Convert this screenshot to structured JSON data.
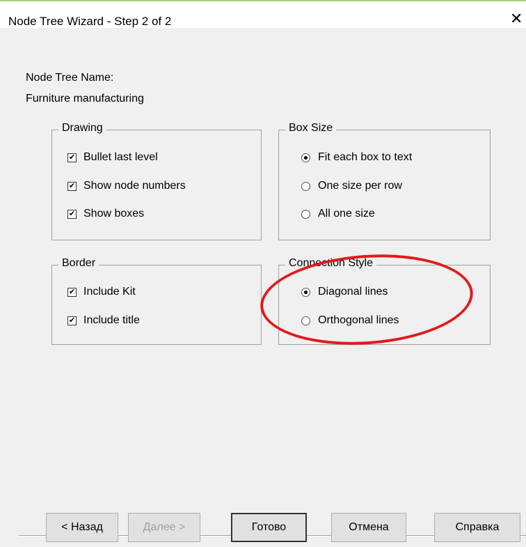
{
  "window": {
    "title": "Node Tree Wizard - Step 2 of 2",
    "close_glyph": "✕"
  },
  "node_tree": {
    "label": "Node Tree Name:",
    "value": "Furniture manufacturing"
  },
  "drawing": {
    "legend": "Drawing",
    "items": [
      {
        "label": "Bullet last level",
        "checked": true
      },
      {
        "label": "Show node numbers",
        "checked": true
      },
      {
        "label": "Show boxes",
        "checked": true
      }
    ]
  },
  "box_size": {
    "legend": "Box Size",
    "items": [
      {
        "label": "Fit each box to text",
        "selected": true
      },
      {
        "label": "One size per row",
        "selected": false
      },
      {
        "label": "All one size",
        "selected": false
      }
    ]
  },
  "border": {
    "legend": "Border",
    "items": [
      {
        "label": "Include Kit",
        "checked": true
      },
      {
        "label": "Include title",
        "checked": true
      }
    ]
  },
  "connection_style": {
    "legend": "Connection Style",
    "items": [
      {
        "label": "Diagonal lines",
        "selected": true
      },
      {
        "label": "Orthogonal lines",
        "selected": false
      }
    ]
  },
  "buttons": {
    "back": "< Назад",
    "next": "Далее >",
    "finish": "Готово",
    "cancel": "Отмена",
    "help": "Справка"
  },
  "colors": {
    "annotation": "#e21a1a",
    "title_accent": "#a9cf7e"
  },
  "check_glyph": "✔"
}
